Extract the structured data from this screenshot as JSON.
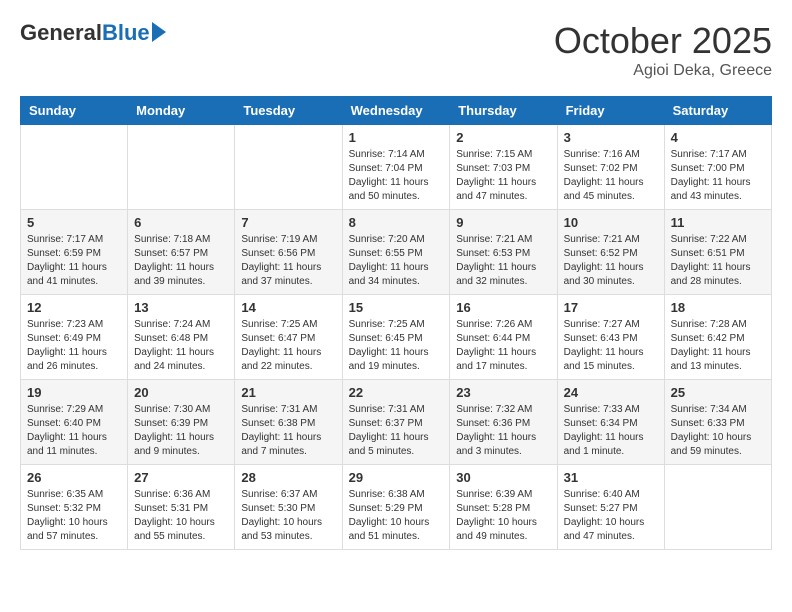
{
  "logo": {
    "general": "General",
    "blue": "Blue"
  },
  "header": {
    "month": "October 2025",
    "location": "Agioi Deka, Greece"
  },
  "weekdays": [
    "Sunday",
    "Monday",
    "Tuesday",
    "Wednesday",
    "Thursday",
    "Friday",
    "Saturday"
  ],
  "weeks": [
    [
      {
        "day": "",
        "info": ""
      },
      {
        "day": "",
        "info": ""
      },
      {
        "day": "",
        "info": ""
      },
      {
        "day": "1",
        "info": "Sunrise: 7:14 AM\nSunset: 7:04 PM\nDaylight: 11 hours and 50 minutes."
      },
      {
        "day": "2",
        "info": "Sunrise: 7:15 AM\nSunset: 7:03 PM\nDaylight: 11 hours and 47 minutes."
      },
      {
        "day": "3",
        "info": "Sunrise: 7:16 AM\nSunset: 7:02 PM\nDaylight: 11 hours and 45 minutes."
      },
      {
        "day": "4",
        "info": "Sunrise: 7:17 AM\nSunset: 7:00 PM\nDaylight: 11 hours and 43 minutes."
      }
    ],
    [
      {
        "day": "5",
        "info": "Sunrise: 7:17 AM\nSunset: 6:59 PM\nDaylight: 11 hours and 41 minutes."
      },
      {
        "day": "6",
        "info": "Sunrise: 7:18 AM\nSunset: 6:57 PM\nDaylight: 11 hours and 39 minutes."
      },
      {
        "day": "7",
        "info": "Sunrise: 7:19 AM\nSunset: 6:56 PM\nDaylight: 11 hours and 37 minutes."
      },
      {
        "day": "8",
        "info": "Sunrise: 7:20 AM\nSunset: 6:55 PM\nDaylight: 11 hours and 34 minutes."
      },
      {
        "day": "9",
        "info": "Sunrise: 7:21 AM\nSunset: 6:53 PM\nDaylight: 11 hours and 32 minutes."
      },
      {
        "day": "10",
        "info": "Sunrise: 7:21 AM\nSunset: 6:52 PM\nDaylight: 11 hours and 30 minutes."
      },
      {
        "day": "11",
        "info": "Sunrise: 7:22 AM\nSunset: 6:51 PM\nDaylight: 11 hours and 28 minutes."
      }
    ],
    [
      {
        "day": "12",
        "info": "Sunrise: 7:23 AM\nSunset: 6:49 PM\nDaylight: 11 hours and 26 minutes."
      },
      {
        "day": "13",
        "info": "Sunrise: 7:24 AM\nSunset: 6:48 PM\nDaylight: 11 hours and 24 minutes."
      },
      {
        "day": "14",
        "info": "Sunrise: 7:25 AM\nSunset: 6:47 PM\nDaylight: 11 hours and 22 minutes."
      },
      {
        "day": "15",
        "info": "Sunrise: 7:25 AM\nSunset: 6:45 PM\nDaylight: 11 hours and 19 minutes."
      },
      {
        "day": "16",
        "info": "Sunrise: 7:26 AM\nSunset: 6:44 PM\nDaylight: 11 hours and 17 minutes."
      },
      {
        "day": "17",
        "info": "Sunrise: 7:27 AM\nSunset: 6:43 PM\nDaylight: 11 hours and 15 minutes."
      },
      {
        "day": "18",
        "info": "Sunrise: 7:28 AM\nSunset: 6:42 PM\nDaylight: 11 hours and 13 minutes."
      }
    ],
    [
      {
        "day": "19",
        "info": "Sunrise: 7:29 AM\nSunset: 6:40 PM\nDaylight: 11 hours and 11 minutes."
      },
      {
        "day": "20",
        "info": "Sunrise: 7:30 AM\nSunset: 6:39 PM\nDaylight: 11 hours and 9 minutes."
      },
      {
        "day": "21",
        "info": "Sunrise: 7:31 AM\nSunset: 6:38 PM\nDaylight: 11 hours and 7 minutes."
      },
      {
        "day": "22",
        "info": "Sunrise: 7:31 AM\nSunset: 6:37 PM\nDaylight: 11 hours and 5 minutes."
      },
      {
        "day": "23",
        "info": "Sunrise: 7:32 AM\nSunset: 6:36 PM\nDaylight: 11 hours and 3 minutes."
      },
      {
        "day": "24",
        "info": "Sunrise: 7:33 AM\nSunset: 6:34 PM\nDaylight: 11 hours and 1 minute."
      },
      {
        "day": "25",
        "info": "Sunrise: 7:34 AM\nSunset: 6:33 PM\nDaylight: 10 hours and 59 minutes."
      }
    ],
    [
      {
        "day": "26",
        "info": "Sunrise: 6:35 AM\nSunset: 5:32 PM\nDaylight: 10 hours and 57 minutes."
      },
      {
        "day": "27",
        "info": "Sunrise: 6:36 AM\nSunset: 5:31 PM\nDaylight: 10 hours and 55 minutes."
      },
      {
        "day": "28",
        "info": "Sunrise: 6:37 AM\nSunset: 5:30 PM\nDaylight: 10 hours and 53 minutes."
      },
      {
        "day": "29",
        "info": "Sunrise: 6:38 AM\nSunset: 5:29 PM\nDaylight: 10 hours and 51 minutes."
      },
      {
        "day": "30",
        "info": "Sunrise: 6:39 AM\nSunset: 5:28 PM\nDaylight: 10 hours and 49 minutes."
      },
      {
        "day": "31",
        "info": "Sunrise: 6:40 AM\nSunset: 5:27 PM\nDaylight: 10 hours and 47 minutes."
      },
      {
        "day": "",
        "info": ""
      }
    ]
  ]
}
